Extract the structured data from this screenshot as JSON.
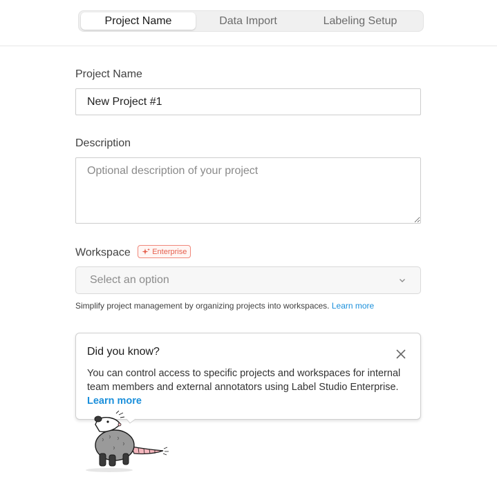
{
  "tabs": [
    {
      "label": "Project Name",
      "active": true
    },
    {
      "label": "Data Import",
      "active": false
    },
    {
      "label": "Labeling Setup",
      "active": false
    }
  ],
  "form": {
    "project_name": {
      "label": "Project Name",
      "value": "New Project #1"
    },
    "description": {
      "label": "Description",
      "placeholder": "Optional description of your project"
    },
    "workspace": {
      "label": "Workspace",
      "badge": "Enterprise",
      "badge_icon": "sparkle-icon",
      "selected": "Select an option",
      "hint": "Simplify project management by organizing projects into workspaces.",
      "hint_link": "Learn more"
    }
  },
  "info_card": {
    "title": "Did you know?",
    "body": "You can control access to specific projects and workspaces for internal team members and external annotators using Label Studio Enterprise.",
    "link": "Learn more",
    "close_icon": "close-icon"
  },
  "mascot": "opossum-mascot",
  "colors": {
    "accent_link": "#1a8fdb",
    "enterprise_badge": "#e5604e",
    "border": "#cccccc"
  }
}
